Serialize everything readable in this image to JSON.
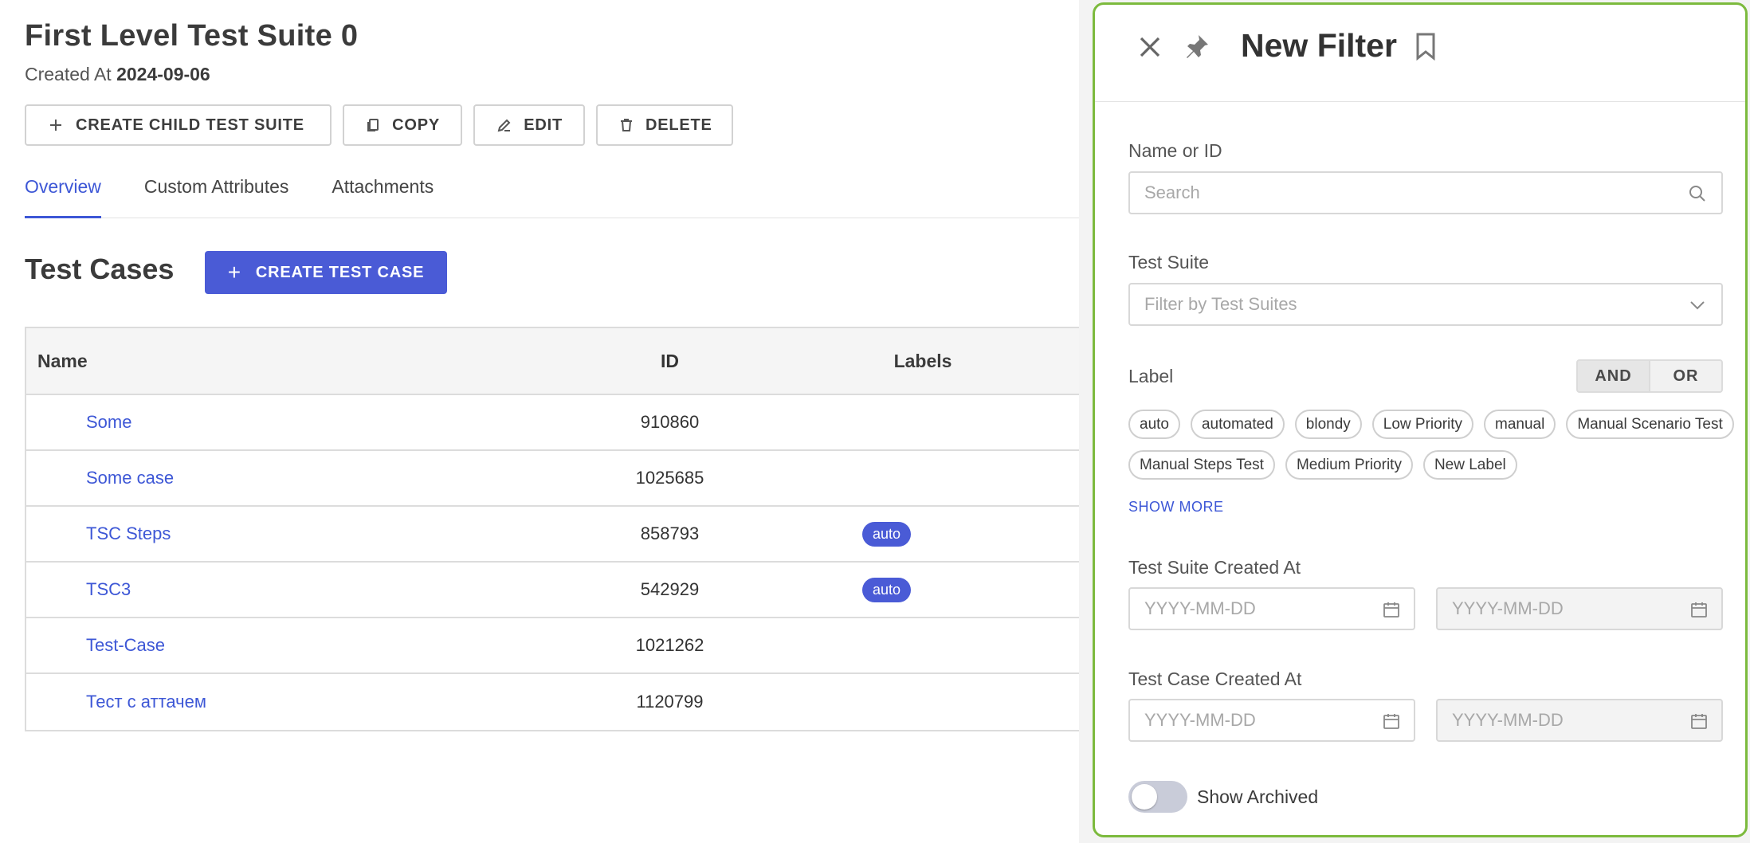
{
  "suite": {
    "title": "First Level Test Suite 0",
    "created_prefix": "Created At",
    "created_date": "2024-09-06"
  },
  "actions": {
    "create_child": "CREATE CHILD TEST SUITE",
    "copy": "COPY",
    "edit": "EDIT",
    "delete": "DELETE"
  },
  "tabs": [
    {
      "label": "Overview",
      "active": true
    },
    {
      "label": "Custom Attributes",
      "active": false
    },
    {
      "label": "Attachments",
      "active": false
    }
  ],
  "test_cases": {
    "title": "Test Cases",
    "create_button": "CREATE TEST CASE",
    "columns": {
      "name": "Name",
      "id": "ID",
      "labels": "Labels"
    },
    "rows": [
      {
        "name": "Some",
        "id": "910860",
        "label": ""
      },
      {
        "name": "Some case",
        "id": "1025685",
        "label": ""
      },
      {
        "name": "TSC Steps",
        "id": "858793",
        "label": "auto"
      },
      {
        "name": "TSC3",
        "id": "542929",
        "label": "auto"
      },
      {
        "name": "Test-Case",
        "id": "1021262",
        "label": ""
      },
      {
        "name": "Тест с аттачем",
        "id": "1120799",
        "label": ""
      }
    ]
  },
  "filter": {
    "title": "New Filter",
    "name_label": "Name or ID",
    "name_placeholder": "Search",
    "suite_label": "Test Suite",
    "suite_placeholder": "Filter by Test Suites",
    "label_label": "Label",
    "and": "AND",
    "or": "OR",
    "chips": [
      "auto",
      "automated",
      "blondy",
      "Low Priority",
      "manual",
      "Manual Scenario Test",
      "Manual Steps Test",
      "Medium Priority",
      "New Label"
    ],
    "show_more": "SHOW MORE",
    "suite_created_label": "Test Suite Created At",
    "case_created_label": "Test Case Created At",
    "date_placeholder": "YYYY-MM-DD",
    "show_archived": "Show Archived",
    "show_archived_on": false
  },
  "colors": {
    "accent": "#4a5bd6",
    "link": "#3d57d6",
    "panel_border": "#7cba3d"
  }
}
